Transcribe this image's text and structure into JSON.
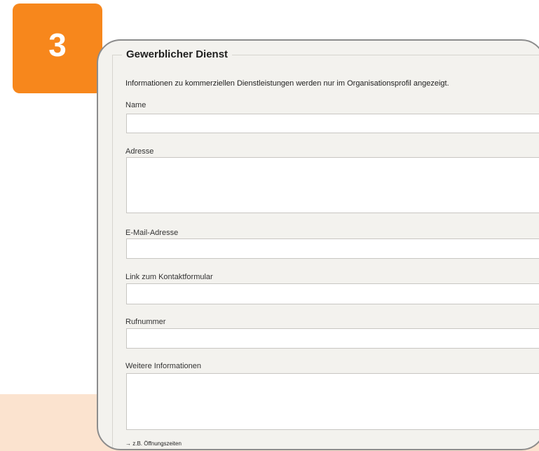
{
  "step_badge": {
    "number": "3",
    "color": "#f7871c"
  },
  "section": {
    "title": "Gewerblicher Dienst",
    "intro": "Informationen zu kommerziellen Dienstleistungen werden nur im Organisationsprofil angezeigt."
  },
  "fields": {
    "name": {
      "label": "Name",
      "value": ""
    },
    "address": {
      "label": "Adresse",
      "value": ""
    },
    "email": {
      "label": "E-Mail-Adresse",
      "value": ""
    },
    "contact_link": {
      "label": "Link zum Kontaktformular",
      "value": ""
    },
    "phone": {
      "label": "Rufnummer",
      "value": ""
    },
    "more_info": {
      "label": "Weitere Informationen",
      "value": "",
      "hint": "→ z.B. Öffnungszeiten"
    }
  },
  "colors": {
    "panel_bg": "#f3f2ee",
    "band_bg": "#fbe3cf"
  }
}
